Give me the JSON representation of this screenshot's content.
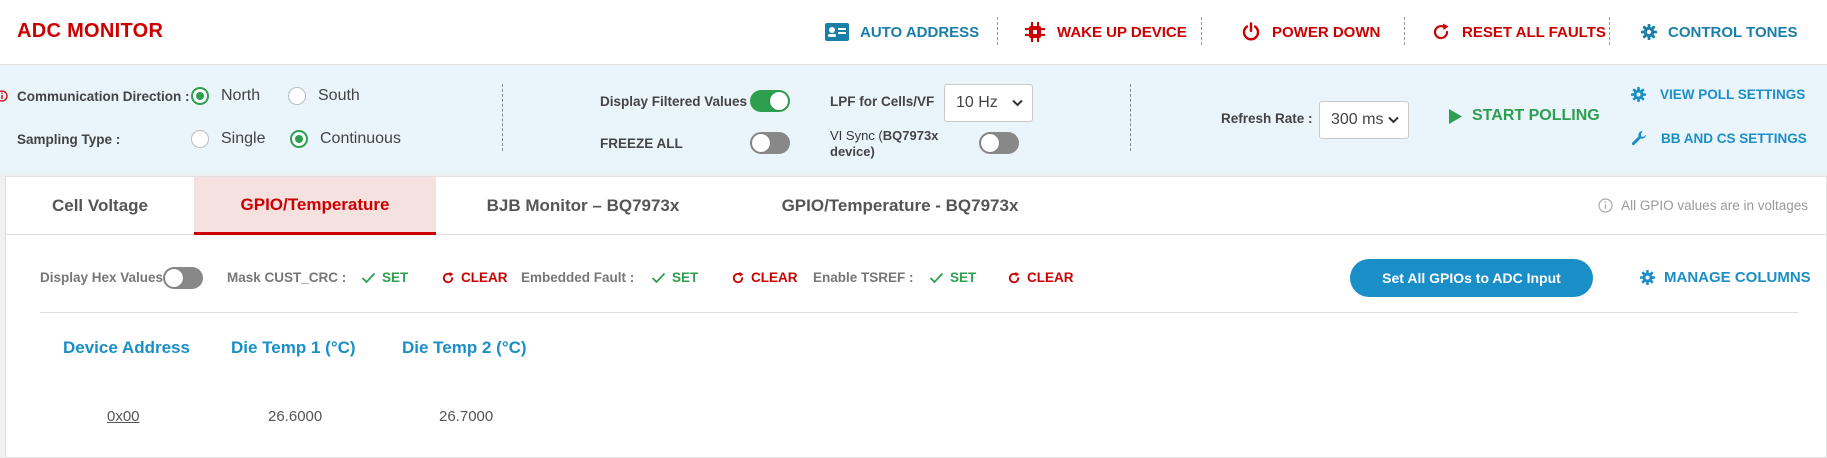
{
  "header": {
    "title": "ADC MONITOR",
    "actions": [
      {
        "label": "AUTO ADDRESS",
        "icon": "id-card-icon",
        "color": "#1a7fa8"
      },
      {
        "label": "WAKE UP DEVICE",
        "icon": "chip-icon",
        "color": "#cc0000"
      },
      {
        "label": "POWER DOWN",
        "icon": "power-icon",
        "color": "#cc0000"
      },
      {
        "label": "RESET ALL FAULTS",
        "icon": "refresh-icon",
        "color": "#cc0000"
      },
      {
        "label": "CONTROL TONES",
        "icon": "gear-icon",
        "color": "#1a7fa8"
      }
    ]
  },
  "controls": {
    "communication_direction": {
      "label": "Communication Direction :",
      "options": [
        "North",
        "South"
      ],
      "selected": "North"
    },
    "sampling_type": {
      "label": "Sampling Type :",
      "options": [
        "Single",
        "Continuous"
      ],
      "selected": "Continuous"
    },
    "display_filtered_values": {
      "label": "Display Filtered Values",
      "on": true
    },
    "freeze_all": {
      "label": "FREEZE ALL",
      "on": false
    },
    "lpf": {
      "label": "LPF for Cells/VF",
      "value": "10 Hz"
    },
    "vi_sync": {
      "label_prefix": "VI Sync (",
      "label_bold": "BQ7973x",
      "label_suffix": "device)",
      "on": false
    },
    "refresh_rate": {
      "label": "Refresh Rate :",
      "value": "300 ms"
    },
    "start_polling": "START POLLING",
    "view_poll_settings": "VIEW POLL SETTINGS",
    "bb_cs_settings": "BB AND CS SETTINGS"
  },
  "tabs": [
    {
      "label": "Cell Voltage",
      "active": false
    },
    {
      "label": "GPIO/Temperature",
      "active": true
    },
    {
      "label": "BJB Monitor – BQ7973x",
      "active": false
    },
    {
      "label": "GPIO/Temperature - BQ7973x",
      "active": false
    }
  ],
  "tab_note": "All GPIO values are in voltages",
  "toolbar": {
    "display_hex": {
      "label": "Display Hex Values",
      "on": false
    },
    "mask_cust_crc": "Mask CUST_CRC :",
    "embedded_fault": "Embedded Fault :",
    "enable_tsref": "Enable TSREF :",
    "set_label": "SET",
    "clear_label": "CLEAR",
    "set_all_gpios": "Set All GPIOs to ADC Input",
    "manage_columns": "MANAGE COLUMNS"
  },
  "table": {
    "columns": [
      "Device Address",
      "Die Temp 1  (°C)",
      "Die Temp 2  (°C)"
    ],
    "rows": [
      [
        "0x00",
        "26.6000",
        "26.7000"
      ]
    ]
  },
  "colors": {
    "brand_red": "#cc0000",
    "accent_blue": "#1a8fc7",
    "success_green": "#2e9e4f"
  }
}
